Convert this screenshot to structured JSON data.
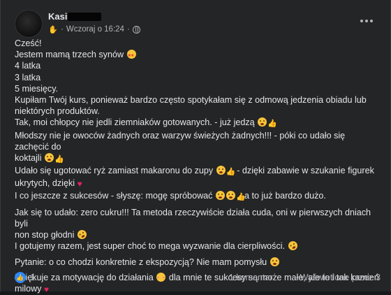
{
  "post": {
    "author": "Kasi",
    "timestamp": "Wczoraj o 16:24",
    "separator": "·",
    "lines": [
      "Cześć!",
      "Jestem mamą trzech synów",
      "4 latka",
      "3 latka",
      "5 miesięcy.",
      "Kupiłam Twój kurs, ponieważ bardzo często spotykałam się z odmową jedzenia obiadu lub",
      "niektórych produktów.",
      "Tak, moi chłopcy nie jedli ziemniaków gotowanych. - już jedzą",
      "Młodszy nie je owoców żadnych oraz warzyw świeżych żadnych!!! - póki co udało się zachęcić do",
      "koktajli",
      "Udało się ugotować ryż zamiast makaronu do zupy",
      "- dzięki zabawie w szukanie figurek",
      "ukrytych, dzięki",
      "I co jeszcze z sukcesów - słyszę: mogę spróbować",
      "a to już bardzo dużo.",
      "Jak się to udało: zero cukru!!! Ta metoda rzeczywiście działa cuda, oni w pierwszych dniach byli",
      "non stop głodni",
      "I gotujemy razem, jest super choć to mega wyzwanie dla cierpliwości.",
      "Pytanie: o co chodzi konkretnie z ekspozycją? Nie mam pomysłu",
      "Dziękuje za motywację do działania",
      "dla mnie te sukcesy są może małe, ale to i tak kamień",
      "milowy"
    ]
  },
  "footer": {
    "like_count": "1",
    "comments": "1 komentarz",
    "views": "Wyświetlone przez 3"
  },
  "icons": {
    "like": "thumbs-up-icon",
    "privacy": "globe-icon",
    "more": "more-options-icon"
  },
  "colors": {
    "background": "#242526",
    "text": "#e4e6eb",
    "secondary_text": "#b0b3b8",
    "like_blue": "#2d88ff"
  }
}
